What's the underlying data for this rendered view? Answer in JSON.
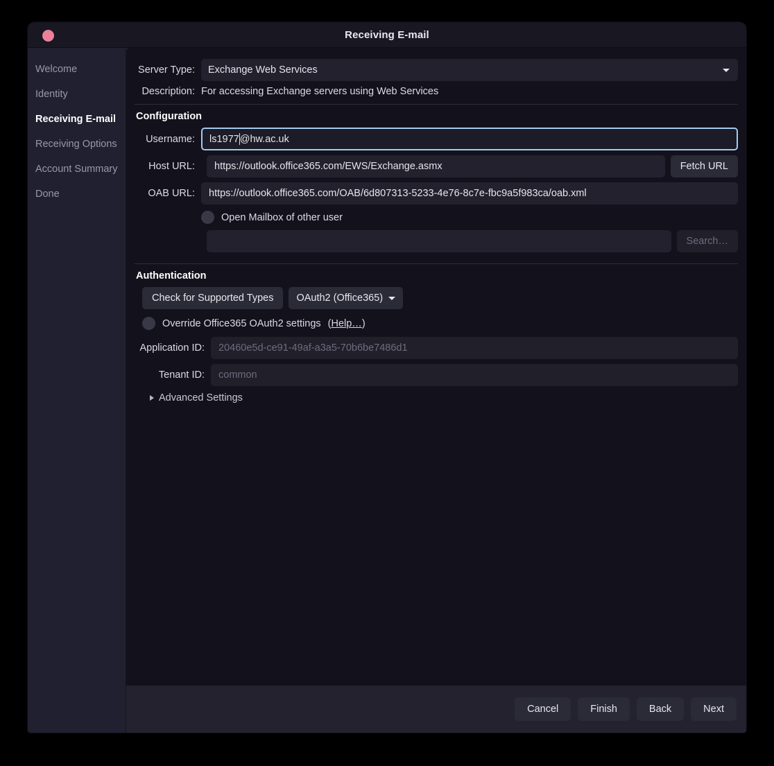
{
  "window": {
    "title": "Receiving E-mail",
    "close_icon": "close-dot-icon"
  },
  "sidebar": {
    "items": [
      {
        "label": "Welcome",
        "active": false
      },
      {
        "label": "Identity",
        "active": false
      },
      {
        "label": "Receiving E-mail",
        "active": true
      },
      {
        "label": "Receiving Options",
        "active": false
      },
      {
        "label": "Account Summary",
        "active": false
      },
      {
        "label": "Done",
        "active": false
      }
    ]
  },
  "form": {
    "server_type_label": "Server Type:",
    "server_type_value": "Exchange Web Services",
    "description_label": "Description:",
    "description_value": "For accessing Exchange servers using Web Services",
    "configuration_heading": "Configuration",
    "username_label": "Username:",
    "username_value_before_caret": "ls1977",
    "username_value_after_caret": "@hw.ac.uk",
    "host_url_label": "Host URL:",
    "host_url_value": "https://outlook.office365.com/EWS/Exchange.asmx",
    "fetch_url_label": "Fetch URL",
    "oab_url_label": "OAB URL:",
    "oab_url_value": "https://outlook.office365.com/OAB/6d807313-5233-4e76-8c7e-fbc9a5f983ca/oab.xml",
    "open_mailbox_label": "Open Mailbox of other user",
    "mailbox_search_value": "",
    "search_button_label": "Search…"
  },
  "authentication": {
    "heading": "Authentication",
    "check_types_label": "Check for Supported Types",
    "auth_method_value": "OAuth2 (Office365)",
    "override_label": "Override Office365 OAuth2 settings",
    "help_prefix": "(",
    "help_label": "Help…",
    "help_suffix": ")",
    "application_id_label": "Application ID:",
    "application_id_value": "20460e5d-ce91-49af-a3a5-70b6be7486d1",
    "tenant_id_label": "Tenant ID:",
    "tenant_id_value": "common",
    "advanced_settings_label": "Advanced Settings"
  },
  "footer": {
    "cancel_label": "Cancel",
    "finish_label": "Finish",
    "back_label": "Back",
    "next_label": "Next"
  },
  "colors": {
    "accent_focus": "#a3cbef",
    "close_dot": "#ec8099",
    "window_bg": "#13121c",
    "sidebar_bg": "#212030",
    "field_bg": "#22212d"
  }
}
